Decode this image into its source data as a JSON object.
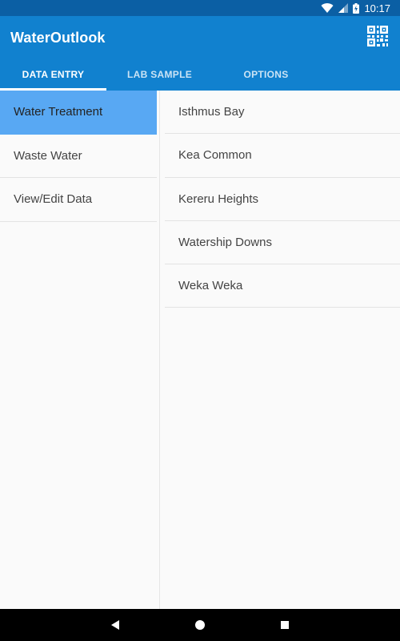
{
  "status_bar": {
    "time": "10:17",
    "icons": [
      "wifi-icon",
      "cellular-signal-icon",
      "battery-charging-icon"
    ]
  },
  "app_bar": {
    "title": "WaterOutlook",
    "action_icon": "qr-code-icon",
    "color": "#1181cf"
  },
  "tabs": [
    {
      "label": "DATA ENTRY",
      "active": true
    },
    {
      "label": "LAB SAMPLE",
      "active": false
    },
    {
      "label": "OPTIONS",
      "active": false
    }
  ],
  "left_menu": {
    "items": [
      {
        "label": "Water Treatment",
        "selected": true
      },
      {
        "label": "Waste Water",
        "selected": false
      },
      {
        "label": "View/Edit Data",
        "selected": false
      }
    ],
    "selected_color": "#58a8f3"
  },
  "right_list": {
    "items": [
      {
        "label": "Isthmus Bay"
      },
      {
        "label": "Kea Common"
      },
      {
        "label": "Kereru Heights"
      },
      {
        "label": "Watership Downs"
      },
      {
        "label": "Weka Weka"
      }
    ]
  },
  "nav_bar": {
    "icons": [
      "back-icon",
      "home-icon",
      "recents-icon"
    ]
  }
}
